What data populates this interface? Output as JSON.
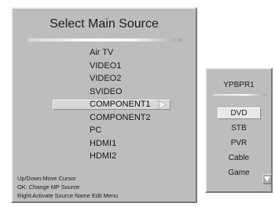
{
  "main_menu": {
    "title": "Select Main Source",
    "sources": [
      {
        "label": "Air TV",
        "selected": false
      },
      {
        "label": "VIDEO1",
        "selected": false
      },
      {
        "label": "VIDEO2",
        "selected": false
      },
      {
        "label": "SVIDEO",
        "selected": false
      },
      {
        "label": "COMPONENT1",
        "selected": true
      },
      {
        "label": "COMPONENT2",
        "selected": false
      },
      {
        "label": "PC",
        "selected": false
      },
      {
        "label": "HDMI1",
        "selected": false
      },
      {
        "label": "HDMI2",
        "selected": false
      }
    ],
    "help": [
      "Up/Down:Move Cursor",
      "OK: Change MP Source",
      "Right:Activate Source Name Edit Menu"
    ],
    "selected_arrow_icon": "chevron-right-icon"
  },
  "sub_menu": {
    "title": "YPBPR1",
    "options": [
      {
        "label": "DVD",
        "selected": true
      },
      {
        "label": "STB",
        "selected": false
      },
      {
        "label": "PVR",
        "selected": false
      },
      {
        "label": "Cable",
        "selected": false
      },
      {
        "label": "Game",
        "selected": false
      }
    ],
    "scroll_icon": "triangle-down-icon"
  },
  "colors": {
    "panel": "#bdbdbd",
    "highlight": "#d7d7d7",
    "text": "#1a1a1a"
  }
}
